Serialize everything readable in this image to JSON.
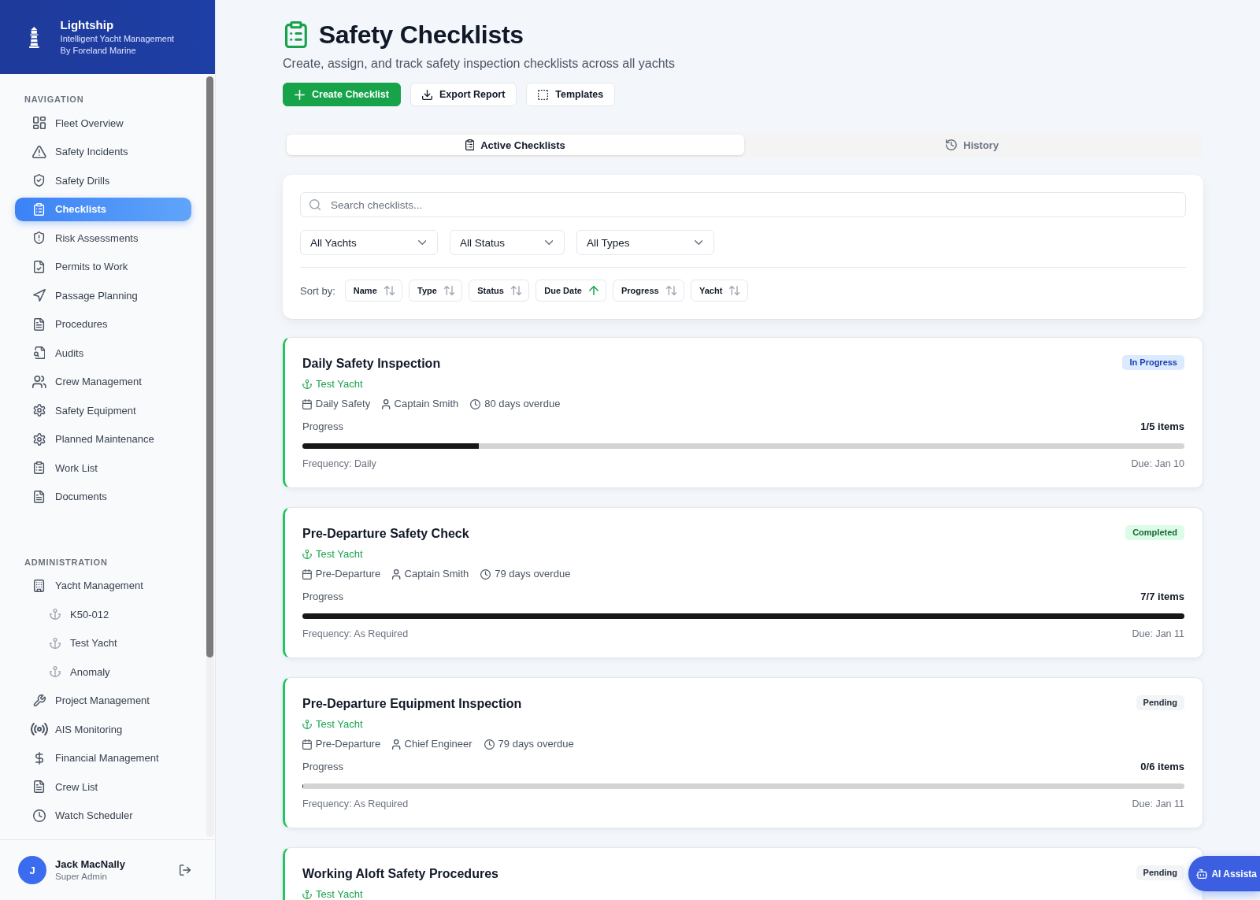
{
  "sidebar": {
    "brand": {
      "name": "Lightship",
      "tagline": "Intelligent Yacht Management",
      "byline": "By Foreland Marine"
    },
    "sections": [
      {
        "heading": "NAVIGATION",
        "items": [
          {
            "label": "Fleet Overview",
            "selected": false
          },
          {
            "label": "Safety Incidents",
            "selected": false
          },
          {
            "label": "Safety Drills",
            "selected": false
          },
          {
            "label": "Checklists",
            "selected": true
          },
          {
            "label": "Risk Assessments",
            "selected": false
          },
          {
            "label": "Permits to Work",
            "selected": false
          },
          {
            "label": "Passage Planning",
            "selected": false
          },
          {
            "label": "Procedures",
            "selected": false
          },
          {
            "label": "Audits",
            "selected": false
          },
          {
            "label": "Crew Management",
            "selected": false
          },
          {
            "label": "Safety Equipment",
            "selected": false
          },
          {
            "label": "Planned Maintenance",
            "selected": false
          },
          {
            "label": "Work List",
            "selected": false
          },
          {
            "label": "Documents",
            "selected": false
          }
        ]
      },
      {
        "heading": "ADMINISTRATION",
        "items": [
          {
            "label": "Yacht Management",
            "selected": false,
            "children": [
              {
                "label": "K50-012",
                "selected": false
              },
              {
                "label": "Test Yacht",
                "selected": false
              },
              {
                "label": "Anomaly",
                "selected": false
              }
            ]
          },
          {
            "label": "Project Management",
            "selected": false
          },
          {
            "label": "AIS Monitoring",
            "selected": false
          },
          {
            "label": "Financial Management",
            "selected": false
          },
          {
            "label": "Crew List",
            "selected": false
          },
          {
            "label": "Watch Scheduler",
            "selected": false
          }
        ]
      }
    ],
    "user": {
      "initial": "J",
      "name": "Jack MacNally",
      "role": "Super Admin"
    }
  },
  "page": {
    "title": "Safety Checklists",
    "subtitle": "Create, assign, and track safety inspection checklists across all yachts",
    "actions": [
      {
        "label": "Create Checklist",
        "kind": "primary"
      },
      {
        "label": "Export Report",
        "kind": "secondary"
      },
      {
        "label": "Templates",
        "kind": "secondary"
      }
    ]
  },
  "tabs": [
    {
      "label": "Active Checklists",
      "selected": true
    },
    {
      "label": "History",
      "selected": false
    }
  ],
  "filters": {
    "search": {
      "placeholder": "Search checklists..."
    },
    "selects": [
      {
        "value": "All Yachts"
      },
      {
        "value": "All Status"
      },
      {
        "value": "All Types"
      }
    ],
    "sort_label": "Sort by:",
    "sort_options": [
      {
        "label": "Name",
        "selected": false
      },
      {
        "label": "Type",
        "selected": false
      },
      {
        "label": "Status",
        "selected": false
      },
      {
        "label": "Due Date",
        "selected": true
      },
      {
        "label": "Progress",
        "selected": false
      },
      {
        "label": "Yacht",
        "selected": false
      }
    ]
  },
  "checklists": [
    {
      "title": "Daily Safety Inspection",
      "status": {
        "label": "In Progress",
        "kind": "in_progress"
      },
      "yacht": "Test Yacht",
      "type": "Daily Safety",
      "assignee": "Captain Smith",
      "due_status": "80 days overdue",
      "progress": {
        "label": "Progress",
        "count": "1/5 items",
        "level": 0.2
      },
      "frequency": "Frequency: Daily",
      "due": "Due: Jan 10"
    },
    {
      "title": "Pre-Departure Safety Check",
      "status": {
        "label": "Completed",
        "kind": "completed"
      },
      "yacht": "Test Yacht",
      "type": "Pre-Departure",
      "assignee": "Captain Smith",
      "due_status": "79 days overdue",
      "progress": {
        "label": "Progress",
        "count": "7/7 items",
        "level": 1
      },
      "frequency": "Frequency: As Required",
      "due": "Due: Jan 11"
    },
    {
      "title": "Pre-Departure Equipment Inspection",
      "status": {
        "label": "Pending",
        "kind": "pending"
      },
      "yacht": "Test Yacht",
      "type": "Pre-Departure",
      "assignee": "Chief Engineer",
      "due_status": "79 days overdue",
      "progress": {
        "label": "Progress",
        "count": "0/6 items",
        "level": 0
      },
      "frequency": "Frequency: As Required",
      "due": "Due: Jan 11"
    },
    {
      "title": "Working Aloft Safety Procedures",
      "status": {
        "label": "Pending",
        "kind": "pending"
      },
      "yacht": "Test Yacht"
    }
  ],
  "assistant": {
    "label": "AI Assista"
  }
}
